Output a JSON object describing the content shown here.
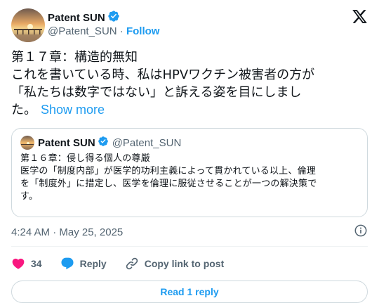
{
  "author": {
    "name": "Patent SUN",
    "handle": "@Patent_SUN",
    "separator": "·",
    "follow_label": "Follow"
  },
  "post": {
    "lines": [
      "第１７章：構造的無知",
      "これを書いている時、私はHPVワクチン被害者の方が",
      "「私たちは数字ではない」と訴える姿を目にしまし",
      "た。"
    ],
    "show_more": "Show more"
  },
  "quote": {
    "name": "Patent SUN",
    "handle": "@Patent_SUN",
    "lines": [
      "第１６章：侵し得る個人の尊厳",
      "医学の「制度内部」が医学的功利主義によって貫かれている以上、倫理",
      "を「制度外」に措定し、医学を倫理に服従させることが一つの解決策で",
      "す。"
    ]
  },
  "meta": {
    "timestamp": "4:24 AM · May 25, 2025"
  },
  "actions": {
    "like_count": "34",
    "reply_label": "Reply",
    "copy_label": "Copy link to post"
  },
  "read_replies_label": "Read 1 reply",
  "colors": {
    "accent": "#1d9bf0",
    "like": "#f91880",
    "muted": "#536471",
    "border": "#cfd9de"
  },
  "icons": [
    "x-logo-icon",
    "verified-badge-icon",
    "info-icon",
    "heart-icon",
    "reply-bubble-icon",
    "link-icon"
  ]
}
